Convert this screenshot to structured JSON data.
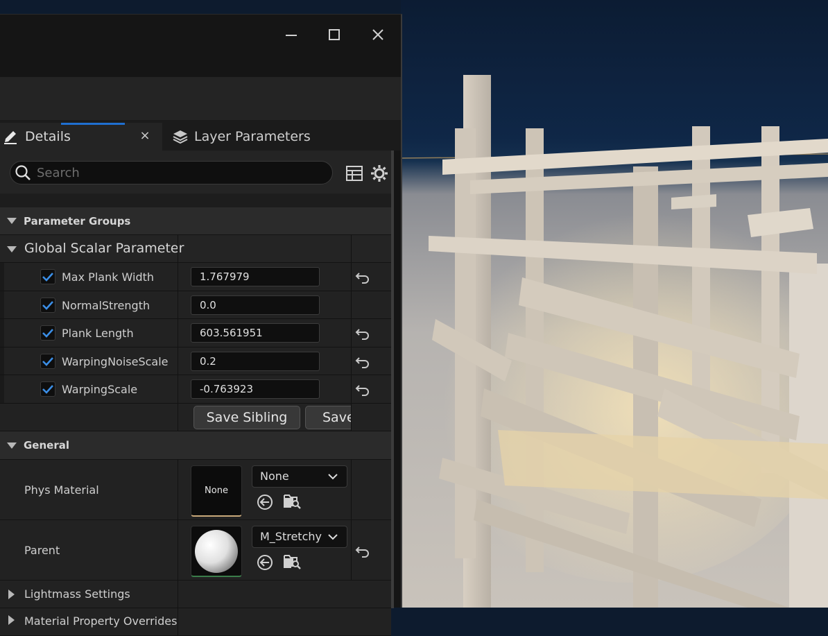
{
  "window": {
    "minimize_glyph": "—",
    "maximize_glyph": "☐",
    "close_glyph": "✕"
  },
  "tabs": {
    "details": {
      "label": "Details",
      "close": "×"
    },
    "layer": {
      "label": "Layer Parameters"
    }
  },
  "search": {
    "placeholder": "Search"
  },
  "sections": {
    "parameter_groups": "Parameter Groups",
    "global_scalar": "Global Scalar Parameter",
    "general": "General",
    "lightmass": "Lightmass Settings",
    "material_overrides": "Material Property Overrides"
  },
  "params": [
    {
      "label": "Max Plank Width",
      "value": "1.767979",
      "checked": true,
      "resettable": true
    },
    {
      "label": "NormalStrength",
      "value": "0.0",
      "checked": true,
      "resettable": false
    },
    {
      "label": "Plank Length",
      "value": "603.561951",
      "checked": true,
      "resettable": true
    },
    {
      "label": "WarpingNoiseScale",
      "value": "0.2",
      "checked": true,
      "resettable": true
    },
    {
      "label": "WarpingScale",
      "value": "-0.763923",
      "checked": true,
      "resettable": true
    }
  ],
  "buttons": {
    "save_sibling": "Save Sibling",
    "save_child": "Save"
  },
  "general": {
    "phys_material": {
      "label": "Phys Material",
      "thumb_text": "None",
      "dropdown": "None"
    },
    "parent": {
      "label": "Parent",
      "dropdown": "M_Stretchy"
    }
  },
  "colors": {
    "accent": "#1f6fd0",
    "checkbox": "#3b8ee6",
    "panel": "#1d1d1d"
  }
}
